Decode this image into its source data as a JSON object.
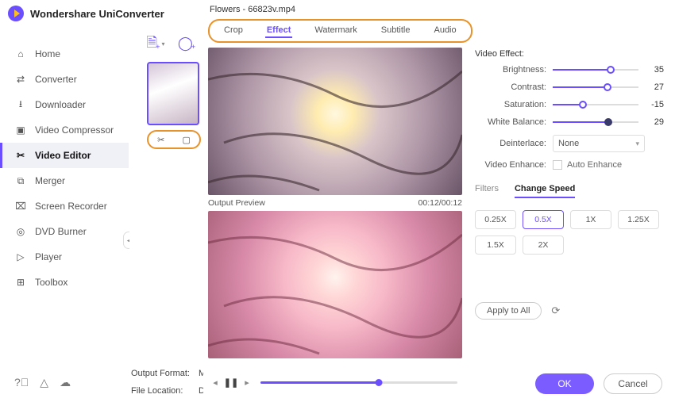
{
  "app_title": "Wondershare UniConverter",
  "dialog_title": "Flowers - 66823v.mp4",
  "sidebar": {
    "items": [
      {
        "label": "Home",
        "icon": "home-icon"
      },
      {
        "label": "Converter",
        "icon": "converter-icon"
      },
      {
        "label": "Downloader",
        "icon": "downloader-icon"
      },
      {
        "label": "Video Compressor",
        "icon": "compressor-icon"
      },
      {
        "label": "Video Editor",
        "icon": "editor-icon"
      },
      {
        "label": "Merger",
        "icon": "merger-icon"
      },
      {
        "label": "Screen Recorder",
        "icon": "recorder-icon"
      },
      {
        "label": "DVD Burner",
        "icon": "dvd-icon"
      },
      {
        "label": "Player",
        "icon": "player-icon"
      },
      {
        "label": "Toolbox",
        "icon": "toolbox-icon"
      }
    ]
  },
  "output": {
    "format_label": "Output Format:",
    "format_value": "M",
    "location_label": "File Location:",
    "location_value": "D"
  },
  "tabs": [
    "Crop",
    "Effect",
    "Watermark",
    "Subtitle",
    "Audio"
  ],
  "active_tab": "Effect",
  "preview": {
    "label": "Output Preview",
    "time": "00:12/00:12"
  },
  "effects": {
    "group_title": "Video Effect:",
    "brightness": {
      "label": "Brightness:",
      "value": 35,
      "pct": 68
    },
    "contrast": {
      "label": "Contrast:",
      "value": 27,
      "pct": 64
    },
    "saturation": {
      "label": "Saturation:",
      "value": -15,
      "pct": 35
    },
    "white_balance": {
      "label": "White Balance:",
      "value": 29,
      "pct": 65
    },
    "deinterlace": {
      "label": "Deinterlace:",
      "value": "None"
    },
    "enhance": {
      "label": "Video Enhance:",
      "checkbox_label": "Auto Enhance"
    }
  },
  "subtabs": {
    "filters": "Filters",
    "speed": "Change Speed"
  },
  "speeds": [
    "0.25X",
    "0.5X",
    "1X",
    "1.25X",
    "1.5X",
    "2X"
  ],
  "selected_speed": "0.5X",
  "apply_all": "Apply to All",
  "buttons": {
    "ok": "OK",
    "cancel": "Cancel"
  }
}
